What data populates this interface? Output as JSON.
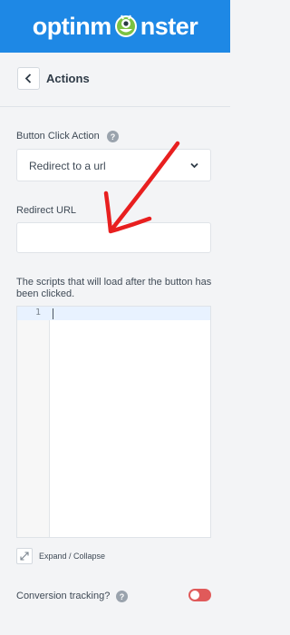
{
  "brand": {
    "logo_text_left": "optinm",
    "logo_text_right": "nster",
    "color": "#1e88e5"
  },
  "header": {
    "back_icon": "chevron-left-icon",
    "title": "Actions"
  },
  "button_click_action": {
    "label": "Button Click Action",
    "help_icon": "question-icon",
    "selected": "Redirect to a url",
    "dropdown_icon": "chevron-down-icon"
  },
  "redirect_url": {
    "label": "Redirect URL",
    "value": ""
  },
  "scripts": {
    "label": "The scripts that will load after the button has been clicked.",
    "line_numbers": [
      "1"
    ]
  },
  "expand": {
    "icon": "expand-icon",
    "label": "Expand / Collapse"
  },
  "conversion_tracking": {
    "label": "Conversion tracking?",
    "help_icon": "question-icon",
    "enabled": false,
    "toggle_color": "#e05a5a"
  },
  "annotation": {
    "arrow_color": "#e81f1f"
  }
}
